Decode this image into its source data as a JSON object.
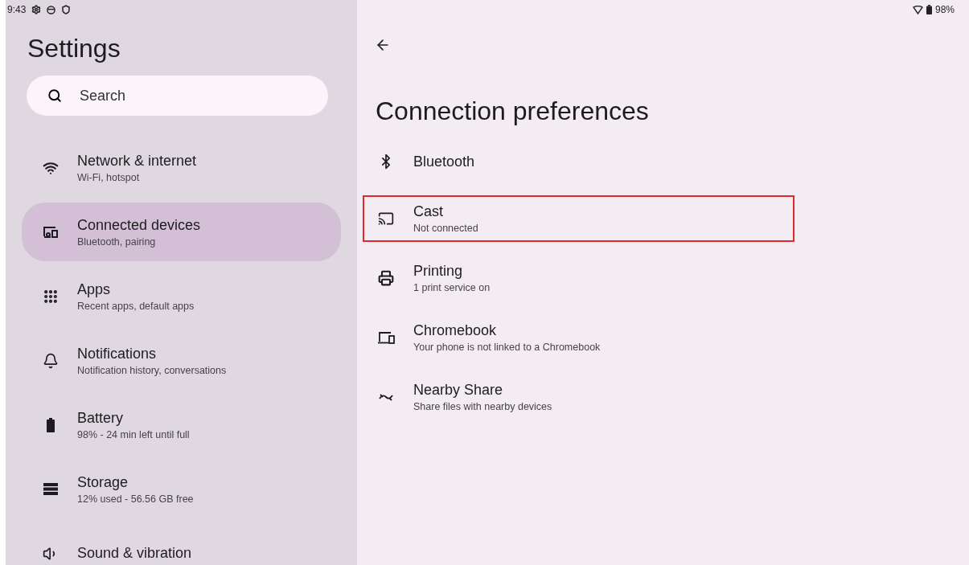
{
  "status_bar": {
    "time": "9:43",
    "battery": "98%"
  },
  "sidebar": {
    "title": "Settings",
    "search": {
      "placeholder": "Search"
    },
    "items": [
      {
        "kind": "wifi",
        "title": "Network & internet",
        "subtitle": "Wi-Fi, hotspot",
        "selected": false
      },
      {
        "kind": "devices",
        "title": "Connected devices",
        "subtitle": "Bluetooth, pairing",
        "selected": true
      },
      {
        "kind": "apps",
        "title": "Apps",
        "subtitle": "Recent apps, default apps",
        "selected": false
      },
      {
        "kind": "bell",
        "title": "Notifications",
        "subtitle": "Notification history, conversations",
        "selected": false
      },
      {
        "kind": "battery",
        "title": "Battery",
        "subtitle": "98% - 24 min left until full",
        "selected": false
      },
      {
        "kind": "storage",
        "title": "Storage",
        "subtitle": "12% used - 56.56 GB free",
        "selected": false
      },
      {
        "kind": "sound",
        "title": "Sound & vibration",
        "selected": false
      }
    ]
  },
  "page": {
    "title": "Connection preferences",
    "items": [
      {
        "kind": "bluetooth",
        "title": "Bluetooth",
        "highlighted": false
      },
      {
        "kind": "cast",
        "title": "Cast",
        "subtitle": "Not connected",
        "highlighted": true
      },
      {
        "kind": "printer",
        "title": "Printing",
        "subtitle": "1 print service on",
        "highlighted": false
      },
      {
        "kind": "laptop",
        "title": "Chromebook",
        "subtitle": "Your phone is not linked to a Chromebook",
        "highlighted": false
      },
      {
        "kind": "nearby",
        "title": "Nearby Share",
        "subtitle": "Share files with nearby devices",
        "highlighted": false
      }
    ]
  }
}
